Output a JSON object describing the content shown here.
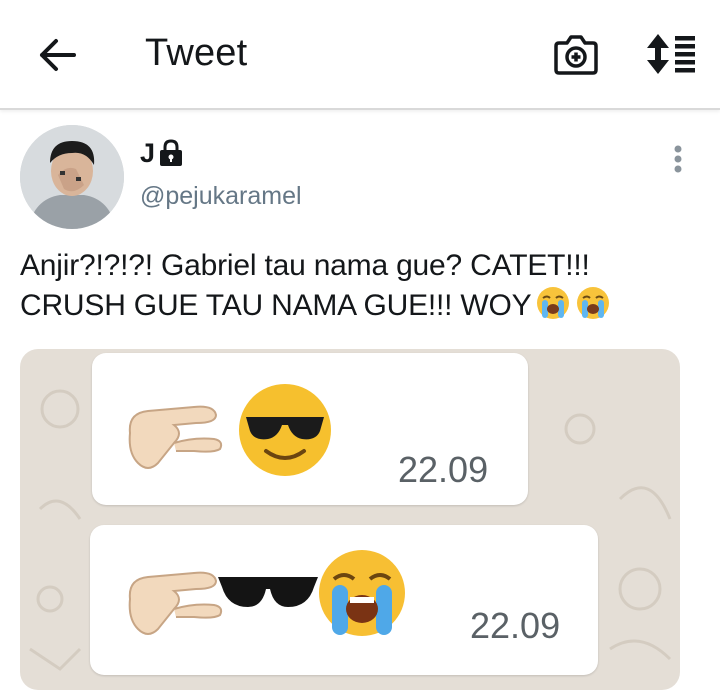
{
  "header": {
    "title": "Tweet",
    "icons": [
      "back-arrow-icon",
      "camera-plus-icon",
      "sort-icon"
    ]
  },
  "tweet": {
    "author_name": "J",
    "author_handle": "@pejukaramel",
    "text": "Anjir?!?!?! Gabriel tau nama gue? CATET!!! CRUSH GUE TAU NAMA GUE!!! WOY",
    "emoji_suffix": [
      "loudly-crying-face",
      "loudly-crying-face"
    ],
    "protected_icon": "lock-icon",
    "more_icon": "vertical-dots-icon"
  },
  "media": {
    "messages": [
      {
        "emojis": [
          "pinching-hand",
          "smiling-face-with-sunglasses"
        ],
        "time": "22.09"
      },
      {
        "emojis": [
          "pinching-hand",
          "sunglasses",
          "loudly-crying-face"
        ],
        "time": "22.09"
      }
    ]
  },
  "colors": {
    "text": "#14171a",
    "secondary": "#657786",
    "chat_background": "#e4ded6",
    "bubble": "#ffffff"
  }
}
